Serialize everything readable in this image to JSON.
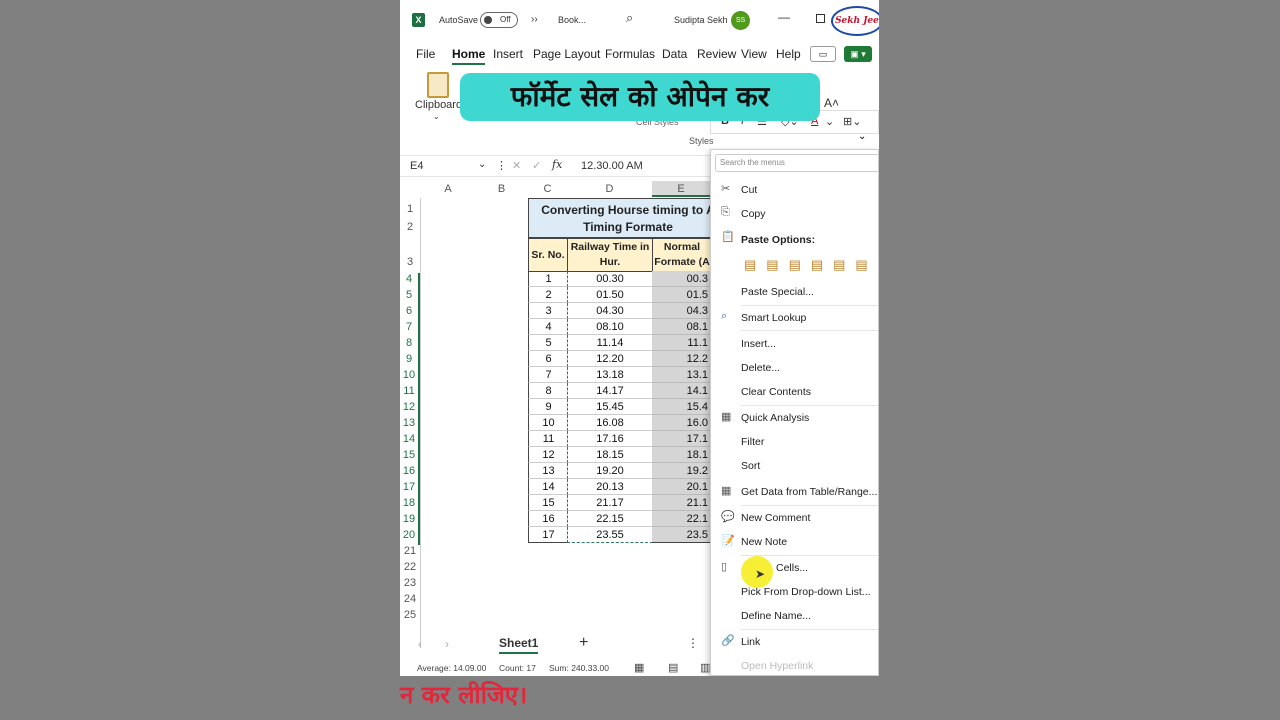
{
  "titlebar": {
    "autosave_label": "AutoSave",
    "toggle_state": "Off",
    "more_chevron": "››",
    "book_name": "Book...",
    "user_name": "Sudipta Sekh",
    "avatar_initials": "SS",
    "brand_text": "Sekh Jee"
  },
  "menu": {
    "file": "File",
    "home": "Home",
    "insert": "Insert",
    "page_layout": "Page Layout",
    "formulas": "Formulas",
    "data": "Data",
    "review": "Review",
    "view": "View",
    "help": "Help"
  },
  "ribbon": {
    "clipboard_label": "Clipboard",
    "banner_text": "फॉर्मेट सेल को ओपेन कर",
    "cell_styles": "Cell Styles",
    "styles_label": "Styles"
  },
  "formula_bar": {
    "name_box": "E4",
    "fx_label": "fx",
    "value": "12.30.00 AM"
  },
  "columns": [
    "A",
    "B",
    "C",
    "D",
    "E"
  ],
  "rows": [
    "1",
    "2",
    "3",
    "4",
    "5",
    "6",
    "7",
    "8",
    "9",
    "10",
    "11",
    "12",
    "13",
    "14",
    "15",
    "16",
    "17",
    "18",
    "19",
    "20",
    "21",
    "22",
    "23",
    "24",
    "25"
  ],
  "table": {
    "title_line1": "Converting Hourse timing to A",
    "title_line2": "Timing Formate",
    "hdr_sr": "Sr. No.",
    "hdr_railway": "Railway Time in Hur.",
    "hdr_normal": "Normal Formate (A",
    "data": [
      [
        "1",
        "00.30",
        "00.3"
      ],
      [
        "2",
        "01.50",
        "01.5"
      ],
      [
        "3",
        "04.30",
        "04.3"
      ],
      [
        "4",
        "08.10",
        "08.1"
      ],
      [
        "5",
        "11.14",
        "11.1"
      ],
      [
        "6",
        "12.20",
        "12.2"
      ],
      [
        "7",
        "13.18",
        "13.1"
      ],
      [
        "8",
        "14.17",
        "14.1"
      ],
      [
        "9",
        "15.45",
        "15.4"
      ],
      [
        "10",
        "16.08",
        "16.0"
      ],
      [
        "11",
        "17.16",
        "17.1"
      ],
      [
        "12",
        "18.15",
        "18.1"
      ],
      [
        "13",
        "19.20",
        "19.2"
      ],
      [
        "14",
        "20.13",
        "20.1"
      ],
      [
        "15",
        "21.17",
        "21.1"
      ],
      [
        "16",
        "22.15",
        "22.1"
      ],
      [
        "17",
        "23.55",
        "23.5"
      ]
    ]
  },
  "sheet_tabs": {
    "active": "Sheet1",
    "add": "+"
  },
  "status": {
    "average": "Average: 14.09.00",
    "count": "Count: 17",
    "sum": "Sum: 240.33.00"
  },
  "context_menu": {
    "search_placeholder": "Search the menus",
    "items": {
      "cut": "Cut",
      "copy": "Copy",
      "paste_options": "Paste Options:",
      "paste_special": "Paste Special...",
      "smart_lookup": "Smart Lookup",
      "insert": "Insert...",
      "delete": "Delete...",
      "clear_contents": "Clear Contents",
      "quick_analysis": "Quick Analysis",
      "filter": "Filter",
      "sort": "Sort",
      "get_data": "Get Data from Table/Range...",
      "new_comment": "New Comment",
      "new_note": "New Note",
      "format_cells": "Cells...",
      "pick_dropdown": "Pick From Drop-down List...",
      "define_name": "Define Name...",
      "link": "Link",
      "open_hyperlink": "Open Hyperlink"
    }
  },
  "caption": {
    "bottom_text": "न कर लीजिए।"
  },
  "colors": {
    "excel_green": "#217346",
    "banner_bg": "#3fd8d1",
    "title_bg": "#ddebf7",
    "header_bg": "#fff2cc",
    "caption_red": "#e4263a",
    "cursor_halo": "#f5ee2a"
  }
}
